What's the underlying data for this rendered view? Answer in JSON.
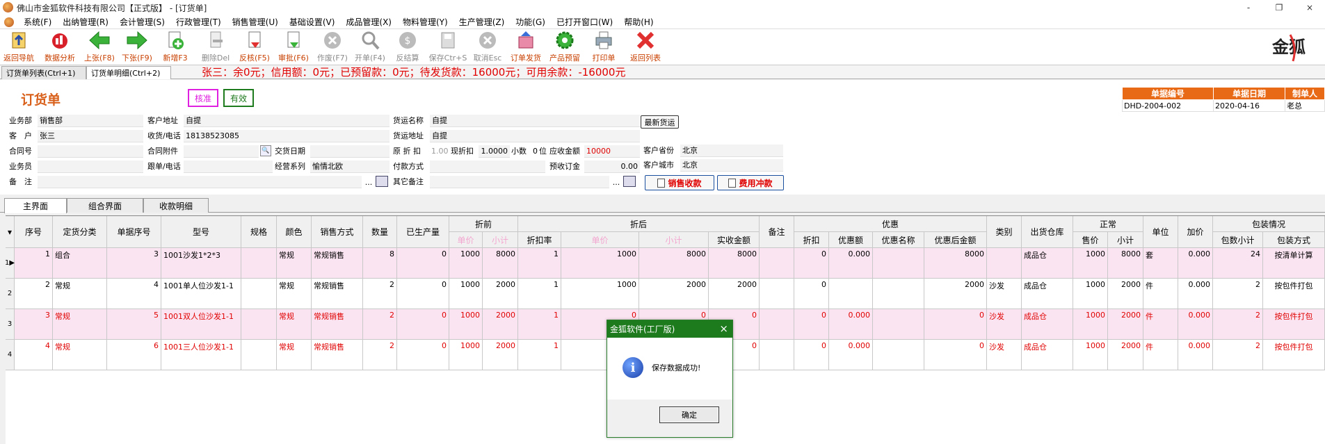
{
  "window": {
    "title": "佛山市金狐软件科技有限公司【正式版】 - [订货单]",
    "btn_min": "-",
    "btn_restore": "❐",
    "btn_close": "×"
  },
  "menu": [
    "系统(F)",
    "出纳管理(R)",
    "会计管理(S)",
    "行政管理(T)",
    "销售管理(U)",
    "基础设置(V)",
    "成品管理(X)",
    "物料管理(Y)",
    "生产管理(Z)",
    "功能(G)",
    "已打开窗口(W)",
    "帮助(H)"
  ],
  "toolbar": [
    {
      "label": "返回导航",
      "icon": "navigate-icon",
      "enabled": true
    },
    {
      "label": "数据分析",
      "icon": "data-analysis-icon",
      "enabled": true
    },
    {
      "label": "上张(F8)",
      "icon": "arrow-left-icon",
      "enabled": true
    },
    {
      "label": "下张(F9)",
      "icon": "arrow-right-icon",
      "enabled": true
    },
    {
      "label": "新增F3",
      "icon": "add-doc-icon",
      "enabled": true
    },
    {
      "label": "删除Del",
      "icon": "delete-doc-icon",
      "enabled": false
    },
    {
      "label": "反核(F5)",
      "icon": "unapprove-icon",
      "enabled": true
    },
    {
      "label": "审批(F6)",
      "icon": "approve-icon",
      "enabled": true
    },
    {
      "label": "作废(F7)",
      "icon": "void-icon",
      "enabled": false
    },
    {
      "label": "开单(F4)",
      "icon": "open-order-icon",
      "enabled": false
    },
    {
      "label": "反结算",
      "icon": "unsettle-icon",
      "enabled": false
    },
    {
      "label": "保存Ctr+S",
      "icon": "save-icon",
      "enabled": false
    },
    {
      "label": "取消Esc",
      "icon": "cancel-icon",
      "enabled": false
    },
    {
      "label": "订单发货",
      "icon": "ship-order-icon",
      "enabled": true
    },
    {
      "label": "产品预留",
      "icon": "reserve-product-icon",
      "enabled": true
    },
    {
      "label": "打印单",
      "icon": "printer-icon",
      "enabled": true
    },
    {
      "label": "返回列表",
      "icon": "close-red-x-icon",
      "enabled": true
    }
  ],
  "tabs_top": [
    {
      "label": "订货单列表(Ctrl+1)"
    },
    {
      "label": "订货单明细(Ctrl+2)"
    }
  ],
  "credit_line": "张三：余0元；信用额：0元；已预留款：0元；待发货款：16000元；可用余款：-16000元",
  "form": {
    "title": "订货单",
    "badge_approved": "核准",
    "badge_valid": "有效",
    "labels": {
      "dept": "业务部",
      "customer": "客　户",
      "contract_no": "合同号",
      "salesman": "业务员",
      "remark": "备　注",
      "cust_addr": "客户地址",
      "recv_phone": "收货/电话",
      "contract_attach": "合同附件",
      "follow_phone": "跟单/电话",
      "deliver_date": "交货日期",
      "series": "经营系列",
      "ship_name": "货运名称",
      "ship_addr": "货运地址",
      "orig_discount": "原 折 扣",
      "cur_discount": "现折扣",
      "decimals": "小数",
      "decimals_unit": "位",
      "receivable": "应收金额",
      "pay_method": "付款方式",
      "prepay": "预收订金",
      "other_remark": "其它备注",
      "cust_province": "客户省份",
      "cust_city": "客户城市"
    },
    "values": {
      "dept": "销售部",
      "customer": "张三",
      "contract_no": "",
      "salesman": "",
      "remark": "",
      "cust_addr": "自提",
      "recv_phone": "18138523085",
      "contract_attach": "",
      "follow_phone": "",
      "series": "愉情北欧",
      "ship_name": "自提",
      "ship_addr": "自提",
      "orig_discount": "1.00",
      "cur_discount": "1.0000",
      "decimals": "0",
      "receivable": "10000",
      "pay_method": "",
      "prepay": "0.00",
      "other_remark": "",
      "cust_province": "北京",
      "cust_city": "北京"
    },
    "btn_latest_ship": "最新货运",
    "btn_sales_receipt": "销售收款",
    "btn_expense_offset": "费用冲款",
    "ellipsis": "...",
    "doc_info": {
      "headers": [
        "单据编号",
        "单据日期",
        "制单人"
      ],
      "values": [
        "DHD-2004-002",
        "2020-04-16",
        "老总"
      ]
    }
  },
  "tabs_bottom": [
    {
      "label": "主界面"
    },
    {
      "label": "组合界面"
    },
    {
      "label": "收款明细"
    }
  ],
  "grid": {
    "groups": {
      "before_discount": "折前",
      "after_discount": "折后",
      "promo": "优惠",
      "normal": "正常",
      "packaging": "包装情况"
    },
    "headers": {
      "seq": "序号",
      "fixed_type": "定货分类",
      "doc_seq": "单据序号",
      "model": "型号",
      "spec": "规格",
      "color": "颜色",
      "sale_method": "销售方式",
      "qty": "数量",
      "produced": "已生产量",
      "unit_price": "单价",
      "subtotal": "小计",
      "discount_rate": "折扣率",
      "paid": "实收金额",
      "note": "备注",
      "promo_discount": "折扣",
      "promo_amount": "优惠额",
      "promo_name": "优惠名称",
      "after_promo": "优惠后金额",
      "category": "类别",
      "warehouse": "出货仓库",
      "sale_price": "售价",
      "n_subtotal": "小计",
      "unit": "单位",
      "markup": "加价",
      "pkg_subtotal": "包数小计",
      "pkg_method": "包装方式"
    },
    "rows": [
      {
        "rn": "1",
        "seq": "1",
        "fixed_type": "组合",
        "doc_seq": "3",
        "model": "1001沙发1*2*3",
        "spec": "",
        "color": "常规",
        "sale_method": "常规销售",
        "qty": "8",
        "produced": "0",
        "bp": "1000",
        "bs": "8000",
        "dr": "1",
        "ap": "1000",
        "as": "8000",
        "paid": "8000",
        "note": "",
        "pd": "0",
        "pa": "0.000",
        "pn": "",
        "apm": "8000",
        "cat": "",
        "wh": "成品仓",
        "sp": "1000",
        "ns": "8000",
        "unit": "套",
        "mk": "0.000",
        "ps": "24",
        "pm": "按清单计算",
        "style": "pink"
      },
      {
        "rn": "2",
        "seq": "2",
        "fixed_type": "常规",
        "doc_seq": "4",
        "model": "1001单人位沙发1-1",
        "spec": "",
        "color": "常规",
        "sale_method": "常规销售",
        "qty": "2",
        "produced": "0",
        "bp": "1000",
        "bs": "2000",
        "dr": "1",
        "ap": "1000",
        "as": "2000",
        "paid": "2000",
        "note": "",
        "pd": "0",
        "pa": "",
        "pn": "",
        "apm": "2000",
        "cat": "沙发",
        "wh": "成品仓",
        "sp": "1000",
        "ns": "2000",
        "unit": "件",
        "mk": "0.000",
        "ps": "2",
        "pm": "按包件打包",
        "style": "white"
      },
      {
        "rn": "3",
        "seq": "3",
        "fixed_type": "常规",
        "doc_seq": "5",
        "model": "1001双人位沙发1-1",
        "spec": "",
        "color": "常规",
        "sale_method": "常规销售",
        "qty": "2",
        "produced": "0",
        "bp": "1000",
        "bs": "2000",
        "dr": "1",
        "ap": "0",
        "as": "0",
        "paid": "0",
        "note": "",
        "pd": "0",
        "pa": "0.000",
        "pn": "",
        "apm": "0",
        "cat": "沙发",
        "wh": "成品仓",
        "sp": "1000",
        "ns": "2000",
        "unit": "件",
        "mk": "0.000",
        "ps": "2",
        "pm": "按包件打包",
        "style": "pink red"
      },
      {
        "rn": "4",
        "seq": "4",
        "fixed_type": "常规",
        "doc_seq": "6",
        "model": "1001三人位沙发1-1",
        "spec": "",
        "color": "常规",
        "sale_method": "常规销售",
        "qty": "2",
        "produced": "0",
        "bp": "1000",
        "bs": "2000",
        "dr": "1",
        "ap": "",
        "as": "",
        "paid": "0",
        "note": "",
        "pd": "0",
        "pa": "0.000",
        "pn": "",
        "apm": "0",
        "cat": "沙发",
        "wh": "成品仓",
        "sp": "1000",
        "ns": "2000",
        "unit": "件",
        "mk": "0.000",
        "ps": "2",
        "pm": "按包件打包",
        "style": "white red"
      }
    ]
  },
  "dialog": {
    "title": "金狐软件(工厂版)",
    "message": "保存数据成功!",
    "ok": "确定",
    "close": "×"
  },
  "colors": {
    "accent": "#d8601a",
    "red": "#e00000",
    "green": "#1d7a1d",
    "header_orange": "#e86a16"
  }
}
